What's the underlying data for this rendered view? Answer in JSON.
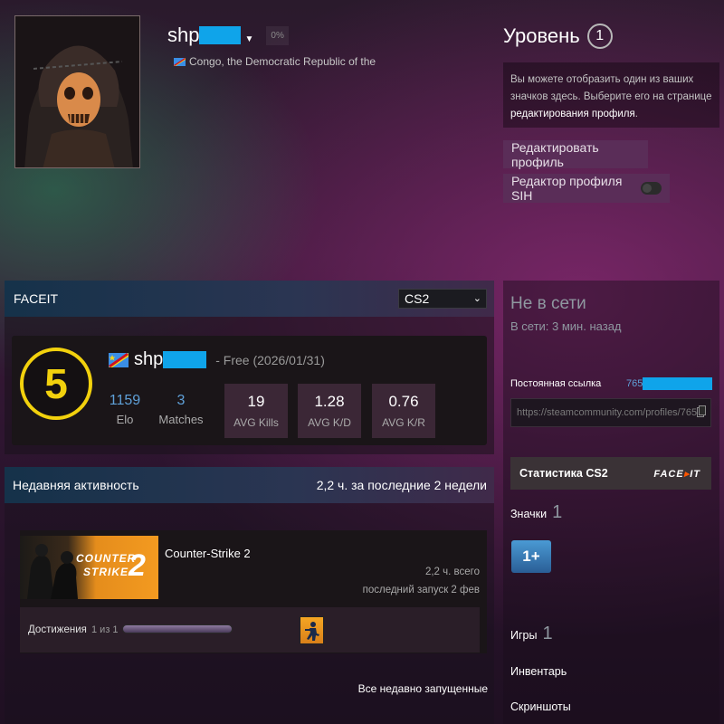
{
  "profile": {
    "nickname": "shp",
    "percent": "0%",
    "country": "Congo, the Democratic Republic of the"
  },
  "level": {
    "label": "Уровень",
    "value": "1"
  },
  "badge_info": {
    "text": "Вы можете отобразить один из ваших значков здесь. Выберите его на странице ",
    "link": "редактирования профиля",
    "tail": "."
  },
  "buttons": {
    "edit_profile": "Редактировать профиль",
    "sih_editor": "Редактор профиля SIH"
  },
  "faceit": {
    "header": "FACEIT",
    "game_selected": "CS2",
    "level": "5",
    "nickname": "shp",
    "subscription": "- Free (2026/01/31)",
    "elo_value": "1159",
    "elo_label": "Elo",
    "matches_value": "3",
    "matches_label": "Matches",
    "stats": [
      {
        "value": "19",
        "label": "AVG Kills"
      },
      {
        "value": "1.28",
        "label": "AVG K/D"
      },
      {
        "value": "0.76",
        "label": "AVG K/R"
      }
    ]
  },
  "recent": {
    "header": "Недавняя активность",
    "summary": "2,2 ч. за последние 2 недели",
    "game": {
      "title": "Counter-Strike 2",
      "hours": "2,2 ч. всего",
      "last_played": "последний запуск 2 фев",
      "capsule_line1": "COUNTER",
      "capsule_line2": "STRIKE",
      "capsule_num": "2"
    },
    "achievements_label": "Достижения",
    "achievements_count": "1 из 1",
    "achievement_progress": 1.0,
    "all_recent": "Все недавно запущенные"
  },
  "sidebar": {
    "status": "Не в сети",
    "last_seen": "В сети: 3 мин. назад",
    "permalink_label": "Постоянная ссылка",
    "permalink_id": "765",
    "permalink_url": "https://steamcommunity.com/profiles/765",
    "stats_button": "Статистика CS2",
    "faceit_logo_a": "FACE",
    "faceit_logo_b": "IT",
    "badges_label": "Значки",
    "badges_count": "1",
    "badge_item": "1+",
    "games_label": "Игры",
    "games_count": "1",
    "inventory_label": "Инвентарь",
    "screenshots_label": "Скриншоты"
  },
  "colors": {
    "accent_blue": "#5fa0d8",
    "faceit_yellow": "#f2d10d",
    "faceit_orange": "#ff5500",
    "redaction": "#0fa4ea",
    "button_purple": "#5a2d58"
  }
}
